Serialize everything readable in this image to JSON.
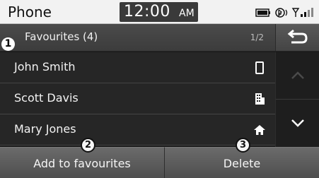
{
  "status_bar": {
    "app_title": "Phone",
    "clock_time": "12:00",
    "clock_ampm": "AM",
    "icons": [
      "battery-icon",
      "bluetooth-audio-icon",
      "signal-strength-icon"
    ]
  },
  "header": {
    "title": "Favourites (4)",
    "page": "1/2",
    "back_icon": "return-arrow-icon"
  },
  "contacts": [
    {
      "name": "John Smith",
      "type_icon": "mobile-phone-icon"
    },
    {
      "name": "Scott Davis",
      "type_icon": "office-building-icon"
    },
    {
      "name": "Mary Jones",
      "type_icon": "home-icon"
    }
  ],
  "scroll": {
    "up_icon": "chevron-up-icon",
    "down_icon": "chevron-down-icon"
  },
  "buttons": {
    "add": "Add to favourites",
    "delete": "Delete"
  },
  "markers": {
    "one": "1",
    "two": "2",
    "three": "3"
  }
}
